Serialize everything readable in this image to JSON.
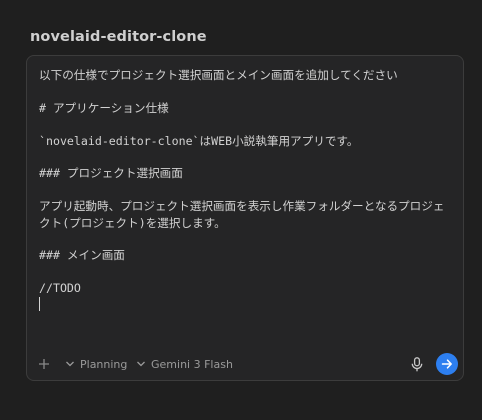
{
  "panel": {
    "title": "novelaid-editor-clone"
  },
  "prompt": {
    "text": "以下の仕様でプロジェクト選択画面とメイン画面を追加してください\n\n# アプリケーション仕様\n\n`novelaid-editor-clone`はWEB小説執筆用アプリです。\n\n### プロジェクト選択画面\n\nアプリ起動時、プロジェクト選択画面を表示し作業フォルダーとなるプロジェクト(プロジェクト)を選択します。\n\n### メイン画面\n\n//TODO\n"
  },
  "toolbar": {
    "add_icon": "plus-icon",
    "mode_label": "Planning",
    "mode_icon": "chevron-down-icon",
    "model_label": "Gemini 3 Flash",
    "model_icon": "chevron-down-icon",
    "mic_icon": "microphone-icon",
    "send_icon": "arrow-right-icon"
  },
  "colors": {
    "background": "#1f1f1f",
    "panel": "#252526",
    "border": "#3c3c3c",
    "text": "#d2d2d2",
    "muted": "#9a9a9a",
    "accent": "#2d7ff0"
  }
}
